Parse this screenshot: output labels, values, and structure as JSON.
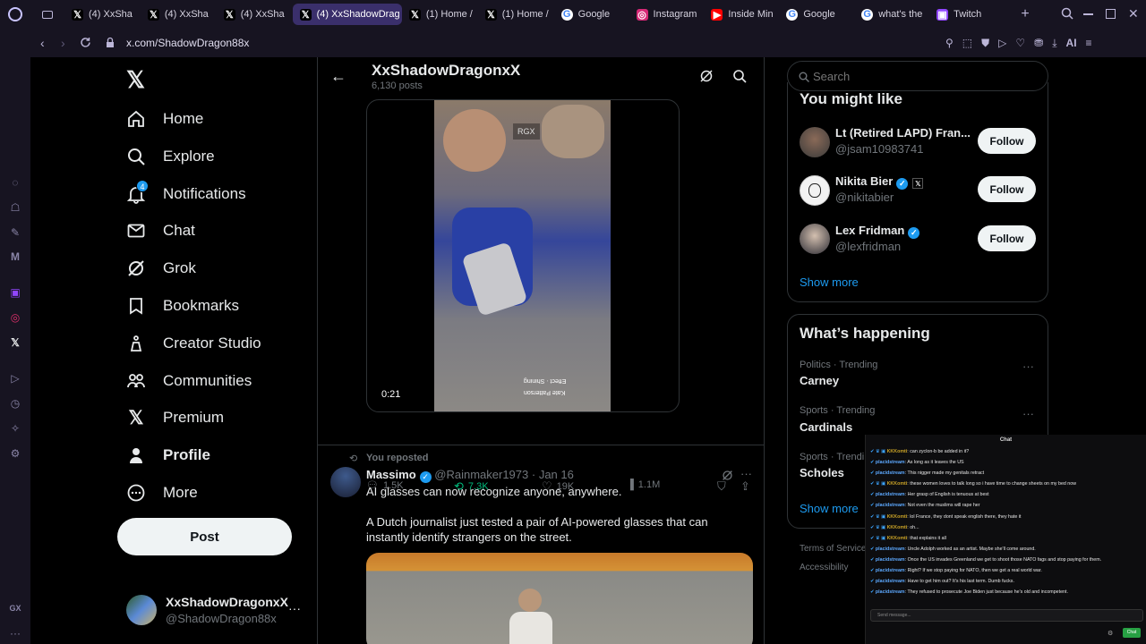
{
  "browser": {
    "tabs": [
      {
        "label": "(4) XxSha",
        "icon": "x-icon"
      },
      {
        "label": "(4) XxSha",
        "icon": "x-icon"
      },
      {
        "label": "(4) XxSha",
        "icon": "x-icon"
      },
      {
        "label": "(4) XxShadowDrag",
        "icon": "x-icon",
        "active": true
      },
      {
        "label": "(1) Home /",
        "icon": "x-icon"
      },
      {
        "label": "(1) Home /",
        "icon": "x-icon"
      },
      {
        "label": "Google",
        "icon": "google-icon"
      },
      {
        "label": "Instagram",
        "icon": "instagram-icon"
      },
      {
        "label": "Inside Min",
        "icon": "youtube-icon"
      },
      {
        "label": "Google",
        "icon": "google-icon"
      },
      {
        "label": "what's the",
        "icon": "google-icon"
      },
      {
        "label": "Twitch",
        "icon": "twitch-icon"
      }
    ],
    "url": "x.com/ShadowDragon88x",
    "ai_label": "AI",
    "gx_label": "GX"
  },
  "nav": {
    "items": [
      {
        "label": "Home",
        "icon": "home-icon"
      },
      {
        "label": "Explore",
        "icon": "search-icon"
      },
      {
        "label": "Notifications",
        "icon": "bell-icon",
        "badge": "4"
      },
      {
        "label": "Chat",
        "icon": "mail-icon"
      },
      {
        "label": "Grok",
        "icon": "grok-icon"
      },
      {
        "label": "Bookmarks",
        "icon": "bookmark-icon"
      },
      {
        "label": "Creator Studio",
        "icon": "creator-studio-icon"
      },
      {
        "label": "Communities",
        "icon": "communities-icon"
      },
      {
        "label": "Premium",
        "icon": "x-icon"
      },
      {
        "label": "Profile",
        "icon": "person-icon"
      },
      {
        "label": "More",
        "icon": "more-circle-icon"
      }
    ],
    "post_label": "Post",
    "account": {
      "name": "XxShadowDragonxX",
      "handle": "@ShadowDragon88x"
    }
  },
  "profile_header": {
    "name": "XxShadowDragonxX",
    "posts": "6,130 posts"
  },
  "video_post": {
    "watermark": "RGX",
    "time": "0:21",
    "caption_lines": [
      "Effect · Shining",
      "Kate Patterson"
    ],
    "replies": "1.5K",
    "reposts": "7.3K",
    "likes": "19K",
    "views": "1.1M"
  },
  "repost": {
    "reposted_label": "You reposted",
    "author": "Massimo",
    "handle": "@Rainmaker1973",
    "date": "· Jan 16",
    "text1": "AI glasses can now recognize anyone, anywhere.",
    "text2": "A Dutch journalist just tested a pair of AI-powered glasses that can instantly identify strangers on the street."
  },
  "search": {
    "placeholder": "Search"
  },
  "you_might_like": {
    "title": "You might like",
    "people": [
      {
        "name": "Lt (Retired LAPD) Fran...",
        "handle": "@jsam10983741",
        "verified": false
      },
      {
        "name": "Nikita Bier",
        "handle": "@nikitabier",
        "verified": true
      },
      {
        "name": "Lex Fridman",
        "handle": "@lexfridman",
        "verified": true
      }
    ],
    "follow_label": "Follow",
    "show_more": "Show more"
  },
  "whats_happening": {
    "title": "What’s happening",
    "trends": [
      {
        "context": "Politics · Trending",
        "topic": "Carney"
      },
      {
        "context": "Sports · Trending",
        "topic": "Cardinals"
      },
      {
        "context": "Sports · Trendi",
        "topic": "Scholes"
      }
    ],
    "show_more": "Show more"
  },
  "footer": {
    "terms": "Terms of Service",
    "accessibility": "Accessibility"
  },
  "chat": {
    "title": "Chat",
    "messages": [
      {
        "user": "KKKomti",
        "text": "can zyclon-b be added in it?"
      },
      {
        "user": "placidstream",
        "text": "As long as it leaves the US"
      },
      {
        "user": "placidstream",
        "text": "This nigger made my genitals retract"
      },
      {
        "user": "KKKomti",
        "text": "these women loves to talk long so i have time to change sheets on my bed now"
      },
      {
        "user": "placidstream",
        "text": "Her grasp of English is tenuous at best"
      },
      {
        "user": "placidstream",
        "text": "Not even the muslims will rape her"
      },
      {
        "user": "KKKomti",
        "text": "lol France, they dont speak english there, they hate it"
      },
      {
        "user": "KKKomti",
        "text": "oh..."
      },
      {
        "user": "KKKomti",
        "text": "that explains it all"
      },
      {
        "user": "placidstream",
        "text": "Uncle Adolph worked as an artist. Maybe she'll come around."
      },
      {
        "user": "placidstream",
        "text": "Once the US invades Greenland we get to shoot those NATO fags and stop paying for them."
      },
      {
        "user": "placidstream",
        "text": "Right? If we stop paying for NATO, then we get a real world war."
      },
      {
        "user": "placidstream",
        "text": "Have to get him out? It's his last term. Dumb fucks."
      },
      {
        "user": "placidstream",
        "text": "They refused to prosecute Joe Biden just because he's old and incompetent."
      }
    ],
    "input_placeholder": "Send message...",
    "chat_button": "Chat"
  },
  "colors": {
    "accent": "#1d9bf0",
    "repost_green": "#00ba7c",
    "tab_active": "#3a2f6b",
    "browser_bg": "#171421"
  }
}
